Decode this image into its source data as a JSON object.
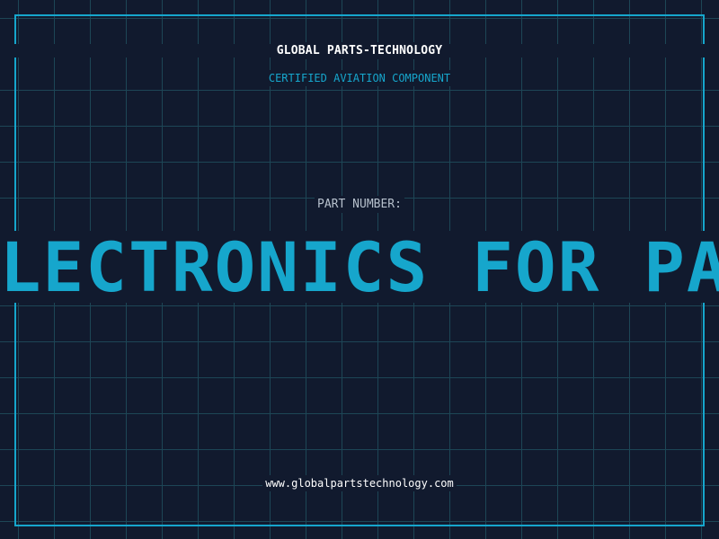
{
  "header": {
    "company": "GLOBAL PARTS-TECHNOLOGY",
    "subtitle": "CERTIFIED AVIATION COMPONENT"
  },
  "part": {
    "label": "PART NUMBER:",
    "value": "ELECTRONICS FOR PARTS"
  },
  "footer": {
    "website": "www.globalpartstechnology.com"
  },
  "colors": {
    "background": "#111a2e",
    "grid": "#1d4656",
    "accent": "#16a6cc",
    "text": "#ffffff",
    "muted": "#b6c0cc"
  }
}
